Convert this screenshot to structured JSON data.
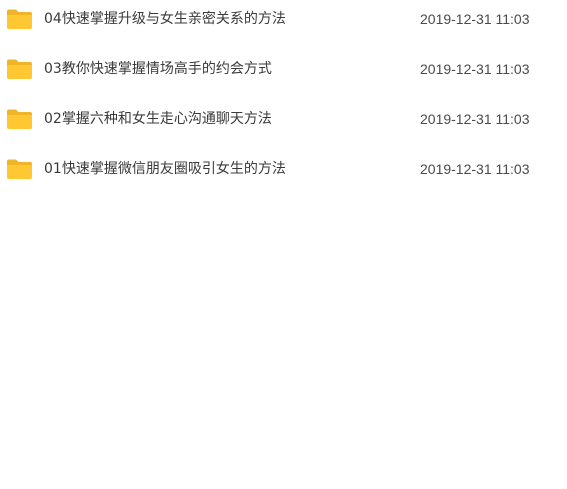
{
  "files": [
    {
      "name": "04快速掌握升级与女生亲密关系的方法",
      "modified": "2019-12-31 11:03",
      "icon": "folder-icon"
    },
    {
      "name": "03教你快速掌握情场高手的约会方式",
      "modified": "2019-12-31 11:03",
      "icon": "folder-icon"
    },
    {
      "name": "02掌握六种和女生走心沟通聊天方法",
      "modified": "2019-12-31 11:03",
      "icon": "folder-icon"
    },
    {
      "name": "01快速掌握微信朋友圈吸引女生的方法",
      "modified": "2019-12-31 11:03",
      "icon": "folder-icon"
    }
  ],
  "colors": {
    "folder": "#FFC832",
    "folder_tab": "#F0B428",
    "text": "#3a3a3a"
  }
}
